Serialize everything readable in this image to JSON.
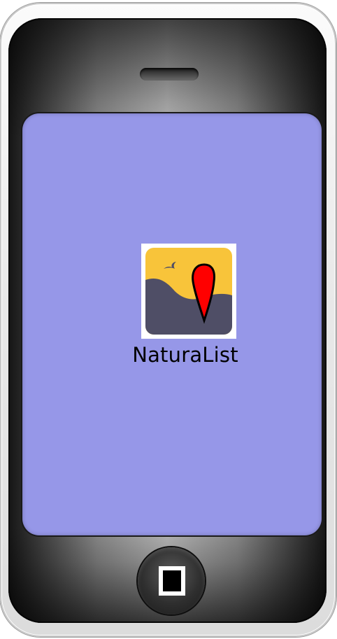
{
  "home_screen": {
    "apps": [
      {
        "label": "NaturaList",
        "icon": "naturalist-map-pin-icon"
      }
    ]
  },
  "colors": {
    "screen_background": "#9697e8",
    "icon_sky": "#f8c43a",
    "icon_ground": "#4f4e66",
    "icon_pin": "#ff0000"
  }
}
